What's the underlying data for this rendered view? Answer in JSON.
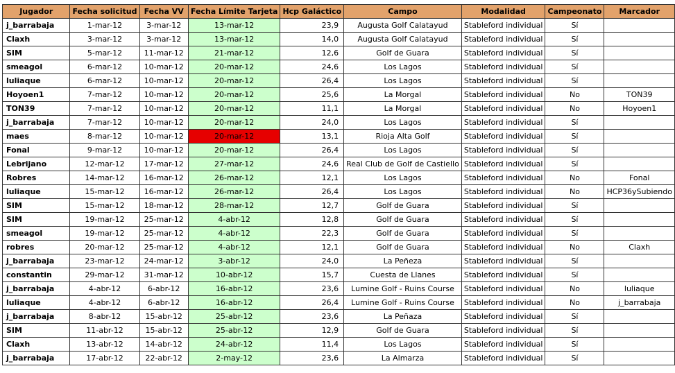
{
  "table": {
    "columns": [
      "Jugador",
      "Fecha solicitud",
      "Fecha VV",
      "Fecha Límite Tarjeta",
      "Hcp Galáctico",
      "Campo",
      "Modalidad",
      "Campeonato",
      "Marcador"
    ],
    "rows": [
      {
        "jugador": "j_barrabaja",
        "solicitud": "1-mar-12",
        "vv": "3-mar-12",
        "limite": "13-mar-12",
        "limite_status": "green",
        "hcp": "23,9",
        "campo": "Augusta Golf Calatayud",
        "modalidad": "Stableford individual",
        "campeonato": "Sí",
        "marcador": ""
      },
      {
        "jugador": "Claxh",
        "solicitud": "3-mar-12",
        "vv": "3-mar-12",
        "limite": "13-mar-12",
        "limite_status": "green",
        "hcp": "14,0",
        "campo": "Augusta Golf Calatayud",
        "modalidad": "Stableford individual",
        "campeonato": "Sí",
        "marcador": ""
      },
      {
        "jugador": "SIM",
        "solicitud": "5-mar-12",
        "vv": "11-mar-12",
        "limite": "21-mar-12",
        "limite_status": "green",
        "hcp": "12,6",
        "campo": "Golf de Guara",
        "modalidad": "Stableford individual",
        "campeonato": "Sí",
        "marcador": ""
      },
      {
        "jugador": "smeagol",
        "solicitud": "6-mar-12",
        "vv": "10-mar-12",
        "limite": "20-mar-12",
        "limite_status": "green",
        "hcp": "24,6",
        "campo": "Los Lagos",
        "modalidad": "Stableford individual",
        "campeonato": "Sí",
        "marcador": ""
      },
      {
        "jugador": "luliaque",
        "solicitud": "6-mar-12",
        "vv": "10-mar-12",
        "limite": "20-mar-12",
        "limite_status": "green",
        "hcp": "26,4",
        "campo": "Los Lagos",
        "modalidad": "Stableford individual",
        "campeonato": "Sí",
        "marcador": ""
      },
      {
        "jugador": "Hoyoen1",
        "solicitud": "7-mar-12",
        "vv": "10-mar-12",
        "limite": "20-mar-12",
        "limite_status": "green",
        "hcp": "25,6",
        "campo": "La Morgal",
        "modalidad": "Stableford individual",
        "campeonato": "No",
        "marcador": "TON39"
      },
      {
        "jugador": "TON39",
        "solicitud": "7-mar-12",
        "vv": "10-mar-12",
        "limite": "20-mar-12",
        "limite_status": "green",
        "hcp": "11,1",
        "campo": "La Morgal",
        "modalidad": "Stableford individual",
        "campeonato": "No",
        "marcador": "Hoyoen1"
      },
      {
        "jugador": "j_barrabaja",
        "solicitud": "7-mar-12",
        "vv": "10-mar-12",
        "limite": "20-mar-12",
        "limite_status": "green",
        "hcp": "24,0",
        "campo": "Los Lagos",
        "modalidad": "Stableford individual",
        "campeonato": "Sí",
        "marcador": ""
      },
      {
        "jugador": "maes",
        "solicitud": "8-mar-12",
        "vv": "10-mar-12",
        "limite": "20-mar-12",
        "limite_status": "red",
        "hcp": "13,1",
        "campo": "Rioja Alta Golf",
        "modalidad": "Stableford individual",
        "campeonato": "Sí",
        "marcador": ""
      },
      {
        "jugador": "Fonal",
        "solicitud": "9-mar-12",
        "vv": "10-mar-12",
        "limite": "20-mar-12",
        "limite_status": "green",
        "hcp": "26,4",
        "campo": "Los Lagos",
        "modalidad": "Stableford individual",
        "campeonato": "Sí",
        "marcador": ""
      },
      {
        "jugador": "Lebrijano",
        "solicitud": "12-mar-12",
        "vv": "17-mar-12",
        "limite": "27-mar-12",
        "limite_status": "green",
        "hcp": "24,6",
        "campo": "Real Club de Golf de Castiello",
        "modalidad": "Stableford individual",
        "campeonato": "Sí",
        "marcador": ""
      },
      {
        "jugador": "Robres",
        "solicitud": "14-mar-12",
        "vv": "16-mar-12",
        "limite": "26-mar-12",
        "limite_status": "green",
        "hcp": "12,1",
        "campo": "Los Lagos",
        "modalidad": "Stableford individual",
        "campeonato": "No",
        "marcador": "Fonal"
      },
      {
        "jugador": "luliaque",
        "solicitud": "15-mar-12",
        "vv": "16-mar-12",
        "limite": "26-mar-12",
        "limite_status": "green",
        "hcp": "26,4",
        "campo": "Los Lagos",
        "modalidad": "Stableford individual",
        "campeonato": "No",
        "marcador": "HCP36ySubiendo"
      },
      {
        "jugador": "SIM",
        "solicitud": "15-mar-12",
        "vv": "18-mar-12",
        "limite": "28-mar-12",
        "limite_status": "green",
        "hcp": "12,7",
        "campo": "Golf de Guara",
        "modalidad": "Stableford individual",
        "campeonato": "Sí",
        "marcador": ""
      },
      {
        "jugador": "SIM",
        "solicitud": "19-mar-12",
        "vv": "25-mar-12",
        "limite": "4-abr-12",
        "limite_status": "green",
        "hcp": "12,8",
        "campo": "Golf de Guara",
        "modalidad": "Stableford individual",
        "campeonato": "Sí",
        "marcador": ""
      },
      {
        "jugador": "smeagol",
        "solicitud": "19-mar-12",
        "vv": "25-mar-12",
        "limite": "4-abr-12",
        "limite_status": "green",
        "hcp": "22,3",
        "campo": "Golf de Guara",
        "modalidad": "Stableford individual",
        "campeonato": "Sí",
        "marcador": ""
      },
      {
        "jugador": "robres",
        "solicitud": "20-mar-12",
        "vv": "25-mar-12",
        "limite": "4-abr-12",
        "limite_status": "green",
        "hcp": "12,1",
        "campo": "Golf de Guara",
        "modalidad": "Stableford individual",
        "campeonato": "No",
        "marcador": "Claxh"
      },
      {
        "jugador": "j_barrabaja",
        "solicitud": "23-mar-12",
        "vv": "24-mar-12",
        "limite": "3-abr-12",
        "limite_status": "green",
        "hcp": "24,0",
        "campo": "La Peñeza",
        "modalidad": "Stableford individual",
        "campeonato": "Sí",
        "marcador": ""
      },
      {
        "jugador": "constantin",
        "solicitud": "29-mar-12",
        "vv": "31-mar-12",
        "limite": "10-abr-12",
        "limite_status": "green",
        "hcp": "15,7",
        "campo": "Cuesta de Llanes",
        "modalidad": "Stableford individual",
        "campeonato": "Sí",
        "marcador": ""
      },
      {
        "jugador": "j_barrabaja",
        "solicitud": "4-abr-12",
        "vv": "6-abr-12",
        "limite": "16-abr-12",
        "limite_status": "green",
        "hcp": "23,6",
        "campo": "Lumine Golf - Ruins Course",
        "modalidad": "Stableford individual",
        "campeonato": "No",
        "marcador": "luliaque"
      },
      {
        "jugador": "luliaque",
        "solicitud": "4-abr-12",
        "vv": "6-abr-12",
        "limite": "16-abr-12",
        "limite_status": "green",
        "hcp": "26,4",
        "campo": "Lumine Golf - Ruins Course",
        "modalidad": "Stableford individual",
        "campeonato": "No",
        "marcador": "j_barrabaja"
      },
      {
        "jugador": "j_barrabaja",
        "solicitud": "8-abr-12",
        "vv": "15-abr-12",
        "limite": "25-abr-12",
        "limite_status": "green",
        "hcp": "23,6",
        "campo": "La Peñaza",
        "modalidad": "Stableford individual",
        "campeonato": "Sí",
        "marcador": ""
      },
      {
        "jugador": "SIM",
        "solicitud": "11-abr-12",
        "vv": "15-abr-12",
        "limite": "25-abr-12",
        "limite_status": "green",
        "hcp": "12,9",
        "campo": "Golf de Guara",
        "modalidad": "Stableford individual",
        "campeonato": "Sí",
        "marcador": ""
      },
      {
        "jugador": "Claxh",
        "solicitud": "13-abr-12",
        "vv": "14-abr-12",
        "limite": "24-abr-12",
        "limite_status": "green",
        "hcp": "11,4",
        "campo": "Los Lagos",
        "modalidad": "Stableford individual",
        "campeonato": "Sí",
        "marcador": ""
      },
      {
        "jugador": "j_barrabaja",
        "solicitud": "17-abr-12",
        "vv": "22-abr-12",
        "limite": "2-may-12",
        "limite_status": "green",
        "hcp": "23,6",
        "campo": "La Almarza",
        "modalidad": "Stableford individual",
        "campeonato": "Sí",
        "marcador": ""
      }
    ]
  },
  "colors": {
    "header": "#e2a26b",
    "ok": "#ccffcc",
    "overdue": "#e60000"
  }
}
